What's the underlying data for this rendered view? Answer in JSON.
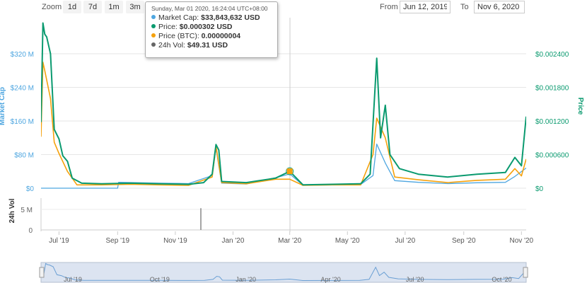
{
  "toolbar": {
    "zoom_label": "Zoom",
    "zoom_buttons": [
      "1d",
      "7d",
      "1m",
      "3m"
    ],
    "from_label": "From",
    "from_value": "Jun 12, 2019",
    "to_label": "To",
    "to_value": "Nov 6, 2020"
  },
  "tooltip": {
    "time": "Sunday, Mar 01 2020, 16:24:04 UTC+08:00",
    "rows": [
      {
        "label": "Market Cap: ",
        "value": "$33,843,632 USD",
        "color": "#4ea6e0"
      },
      {
        "label": "Price: ",
        "value": "$0.000302 USD",
        "color": "#0a9a6f"
      },
      {
        "label": "Price (BTC): ",
        "value": "0.00000004",
        "color": "#f5a10c"
      },
      {
        "label": "24h Vol: ",
        "value": "$49.31 USD",
        "color": "#666666"
      }
    ]
  },
  "chart_data": {
    "type": "line",
    "x_ticks": [
      "Jul '19",
      "Sep '19",
      "Nov '19",
      "Jan '20",
      "Mar '20",
      "May '20",
      "Jul '20",
      "Sep '20",
      "Nov '20"
    ],
    "navigator_ticks": [
      "Jul '19",
      "Oct '19",
      "Jan '20",
      "Apr '20",
      "Jul '20",
      "Oct '20"
    ],
    "left_axis": {
      "label": "Market Cap",
      "ticks": [
        "$0",
        "$80 M",
        "$160 M",
        "$240 M",
        "$320 M"
      ],
      "range": [
        0,
        320
      ],
      "unit": "M USD"
    },
    "right_axis": {
      "label": "Price",
      "ticks": [
        "$0",
        "$0.000600",
        "$0.001200",
        "$0.001800",
        "$0.002400"
      ],
      "range": [
        0,
        0.0024
      ]
    },
    "volume_axis": {
      "label": "24h Vol",
      "ticks": [
        "0",
        "5 M"
      ],
      "range": [
        0,
        5
      ]
    },
    "colors": {
      "market_cap": "#4ea6e0",
      "price": "#0a9a6f",
      "price_btc": "#f5a10c",
      "volume": "#888888"
    },
    "series": [
      {
        "name": "Price",
        "axis": "right",
        "points": [
          [
            "2019-06-12",
            0.00118
          ],
          [
            "2019-06-14",
            0.00295
          ],
          [
            "2019-06-16",
            0.00275
          ],
          [
            "2019-06-18",
            0.0027
          ],
          [
            "2019-06-22",
            0.0024
          ],
          [
            "2019-06-26",
            0.00105
          ],
          [
            "2019-07-01",
            0.00088
          ],
          [
            "2019-07-05",
            0.00058
          ],
          [
            "2019-07-10",
            0.00048
          ],
          [
            "2019-07-15",
            0.00018
          ],
          [
            "2019-07-25",
            9e-05
          ],
          [
            "2019-08-15",
            8e-05
          ],
          [
            "2019-09-15",
            9e-05
          ],
          [
            "2019-10-15",
            8e-05
          ],
          [
            "2019-11-15",
            7e-05
          ],
          [
            "2019-12-01",
            0.0001
          ],
          [
            "2019-12-10",
            0.00025
          ],
          [
            "2019-12-14",
            0.00078
          ],
          [
            "2019-12-17",
            0.00068
          ],
          [
            "2019-12-20",
            0.00012
          ],
          [
            "2020-01-15",
            0.0001
          ],
          [
            "2020-02-15",
            0.00018
          ],
          [
            "2020-03-01",
            0.000302
          ],
          [
            "2020-03-15",
            6e-05
          ],
          [
            "2020-04-15",
            7e-05
          ],
          [
            "2020-05-15",
            8e-05
          ],
          [
            "2020-05-25",
            0.00025
          ],
          [
            "2020-06-01",
            0.00232
          ],
          [
            "2020-06-05",
            0.0009
          ],
          [
            "2020-06-10",
            0.00148
          ],
          [
            "2020-06-15",
            0.0006
          ],
          [
            "2020-06-25",
            0.00035
          ],
          [
            "2020-07-15",
            0.00025
          ],
          [
            "2020-08-15",
            0.0002
          ],
          [
            "2020-09-15",
            0.00025
          ],
          [
            "2020-10-15",
            0.00028
          ],
          [
            "2020-10-25",
            0.00055
          ],
          [
            "2020-11-01",
            0.0004
          ],
          [
            "2020-11-06",
            0.00128
          ]
        ]
      },
      {
        "name": "Price (BTC)",
        "axis": "right",
        "points": [
          [
            "2019-06-12",
            0.00092
          ],
          [
            "2019-06-14",
            0.00225
          ],
          [
            "2019-06-16",
            0.0021
          ],
          [
            "2019-06-22",
            0.0016
          ],
          [
            "2019-06-26",
            0.00082
          ],
          [
            "2019-07-01",
            0.00062
          ],
          [
            "2019-07-10",
            0.0003
          ],
          [
            "2019-07-20",
            6e-05
          ],
          [
            "2019-08-15",
            6e-05
          ],
          [
            "2019-09-15",
            7e-05
          ],
          [
            "2019-10-15",
            6e-05
          ],
          [
            "2019-11-15",
            5e-05
          ],
          [
            "2019-12-10",
            0.0002
          ],
          [
            "2019-12-14",
            0.00075
          ],
          [
            "2019-12-20",
            0.0001
          ],
          [
            "2020-01-15",
            8e-05
          ],
          [
            "2020-02-15",
            0.00016
          ],
          [
            "2020-03-01",
            0.00016
          ],
          [
            "2020-03-15",
            5e-05
          ],
          [
            "2020-04-15",
            6e-05
          ],
          [
            "2020-05-15",
            6e-05
          ],
          [
            "2020-05-28",
            0.0006
          ],
          [
            "2020-06-01",
            0.00125
          ],
          [
            "2020-06-10",
            0.0009
          ],
          [
            "2020-06-20",
            0.0002
          ],
          [
            "2020-07-15",
            0.00015
          ],
          [
            "2020-08-15",
            0.0001
          ],
          [
            "2020-09-15",
            0.00014
          ],
          [
            "2020-10-15",
            0.00016
          ],
          [
            "2020-10-25",
            0.00035
          ],
          [
            "2020-11-01",
            0.00022
          ],
          [
            "2020-11-06",
            0.00052
          ]
        ]
      },
      {
        "name": "Market Cap",
        "axis": "left",
        "points": [
          [
            "2019-06-12",
            0
          ],
          [
            "2019-09-01",
            0
          ],
          [
            "2019-09-02",
            14
          ],
          [
            "2019-10-15",
            12
          ],
          [
            "2019-11-15",
            11
          ],
          [
            "2019-12-10",
            30
          ],
          [
            "2019-12-14",
            95
          ],
          [
            "2019-12-20",
            12
          ],
          [
            "2020-01-15",
            10
          ],
          [
            "2020-02-15",
            25
          ],
          [
            "2020-03-01",
            33.8
          ],
          [
            "2020-03-15",
            7
          ],
          [
            "2020-04-15",
            8
          ],
          [
            "2020-05-15",
            9
          ],
          [
            "2020-05-28",
            30
          ],
          [
            "2020-06-01",
            105
          ],
          [
            "2020-06-10",
            60
          ],
          [
            "2020-06-20",
            18
          ],
          [
            "2020-07-15",
            14
          ],
          [
            "2020-08-15",
            11
          ],
          [
            "2020-09-15",
            13
          ],
          [
            "2020-10-15",
            14
          ],
          [
            "2020-10-25",
            28
          ],
          [
            "2020-11-06",
            48
          ]
        ]
      },
      {
        "name": "24h Vol",
        "axis": "volume",
        "points": [
          [
            "2019-11-28",
            5.3
          ]
        ]
      }
    ]
  }
}
